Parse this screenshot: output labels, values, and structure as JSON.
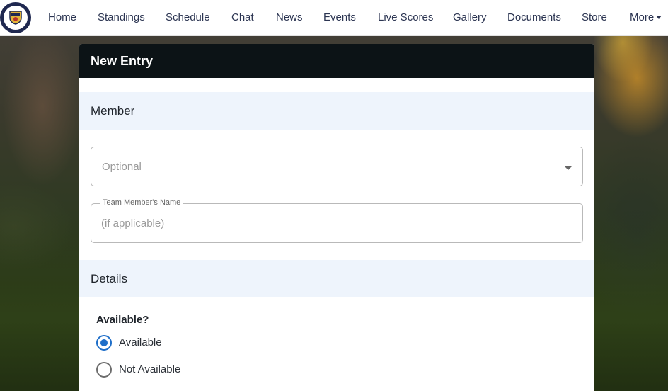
{
  "nav": {
    "logo": "team-crest-icon",
    "items": [
      {
        "label": "Home"
      },
      {
        "label": "Standings"
      },
      {
        "label": "Schedule"
      },
      {
        "label": "Chat"
      },
      {
        "label": "News"
      },
      {
        "label": "Events"
      },
      {
        "label": "Live Scores"
      },
      {
        "label": "Gallery"
      },
      {
        "label": "Documents"
      },
      {
        "label": "Store"
      },
      {
        "label": "More"
      }
    ]
  },
  "form": {
    "title": "New Entry",
    "member_section": "Member",
    "member_select": {
      "placeholder": "Optional",
      "icon": "caret-down-icon"
    },
    "name_field": {
      "label": "Team Member's Name",
      "placeholder": "(if applicable)"
    },
    "details_section": "Details",
    "availability": {
      "label": "Available?",
      "options": [
        {
          "label": "Available",
          "selected": true
        },
        {
          "label": "Not Available",
          "selected": false
        }
      ]
    }
  },
  "colors": {
    "nav_text": "#2c3552",
    "card_header_bg": "#0c1316",
    "section_bg": "#eef4fc",
    "radio_accent": "#1f6fc9",
    "logo_bg": "#1f2850"
  }
}
